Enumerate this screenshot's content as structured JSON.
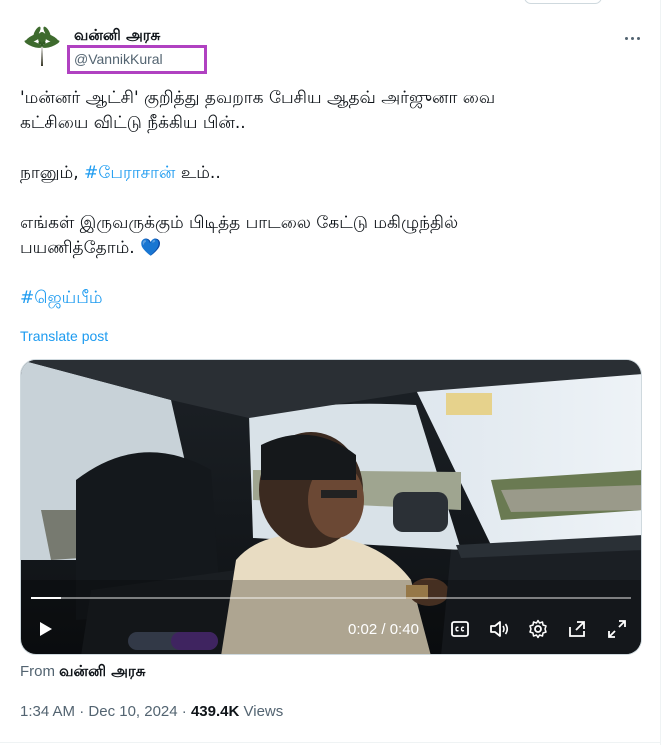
{
  "author": {
    "display_name": "வன்னி அரசு",
    "handle": "@VannikKural",
    "avatar": "palm-tree-avatar"
  },
  "tweet": {
    "lines": [
      "'மன்னர் ஆட்சி' குறித்து தவறாக பேசிய ஆதவ் அர்ஜுனா வை",
      "கட்சியை விட்டு நீக்கிய பின்.."
    ],
    "line2_prefix": "நானும், ",
    "line2_hashtag": "#பேராசான்",
    "line2_suffix": " உம்..",
    "line3": "எங்கள் இருவருக்கும் பிடித்த பாடலை கேட்டு மகிழுந்தில்",
    "line4": "பயணித்தோம். ",
    "heart": "💙",
    "hashtag_footer": "#ஜெய்பீம்",
    "translate_label": "Translate post"
  },
  "video": {
    "current_time": "0:02",
    "separator": " / ",
    "duration": "0:40",
    "progress_fraction": 0.05,
    "icons": [
      "play-icon",
      "captions-icon",
      "volume-icon",
      "settings-icon",
      "dock-icon",
      "fullscreen-icon"
    ]
  },
  "from": {
    "prefix": "From ",
    "name": "வன்னி அரசு"
  },
  "meta": {
    "time": "1:34 AM",
    "dot": " · ",
    "date": "Dec 10, 2024",
    "views_count": "439.4K",
    "views_label": " Views"
  },
  "colors": {
    "link": "#1d9bf0",
    "text": "#0f1419",
    "secondary": "#536471",
    "highlight_box": "#b041c1"
  }
}
